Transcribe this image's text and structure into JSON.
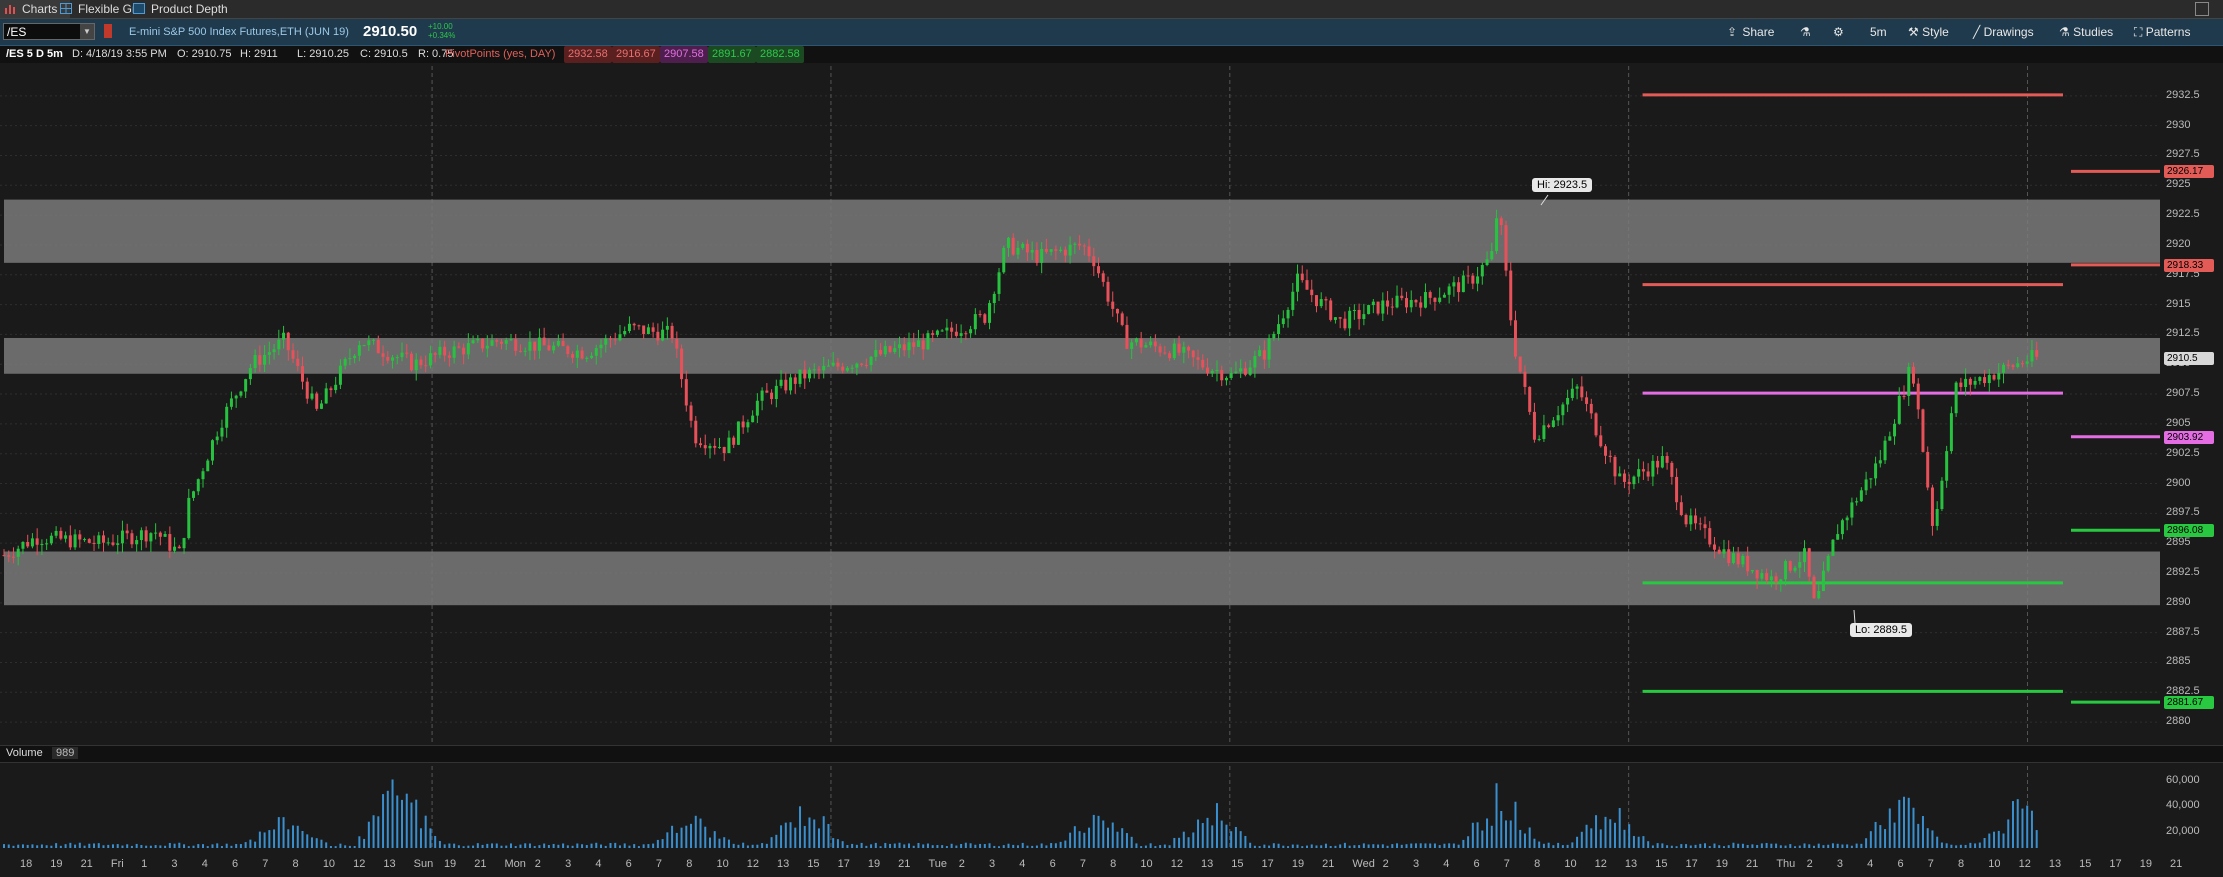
{
  "tabs": [
    {
      "label": "Charts",
      "icon": "bar-chart-icon"
    },
    {
      "label": "Flexible Grid",
      "icon": "grid-icon"
    },
    {
      "label": "Product Depth",
      "icon": "depth-icon"
    }
  ],
  "toolbar": {
    "symbol": "/ES",
    "description": "E-mini S&P 500 Index Futures,ETH (JUN 19)",
    "last_price": "2910.50",
    "change_abs": "+10.00",
    "change_pct": "+0.34%",
    "share_label": "Share",
    "timeframe_label": "5m",
    "style_label": "Style",
    "drawings_label": "Drawings",
    "studies_label": "Studies",
    "patterns_label": "Patterns"
  },
  "info": {
    "chart_label": "/ES 5 D 5m",
    "date": "D: 4/18/19 3:55 PM",
    "open": "O: 2910.75",
    "high": "H: 2911",
    "low": "L: 2910.25",
    "close": "C: 2910.5",
    "range": "R: 0.75",
    "pivot_label": "PivotPoints (yes, DAY)",
    "pivot_values": [
      "2932.58",
      "2916.67",
      "2907.58",
      "2891.67",
      "2882.58"
    ],
    "pivot_colors": [
      "#e0605a",
      "#e0605a",
      "#e070e0",
      "#2ec84a",
      "#2ec84a"
    ]
  },
  "volume": {
    "label": "Volume",
    "value": "989",
    "ticks": [
      "60,000",
      "40,000",
      "20,000"
    ]
  },
  "colors": {
    "up": "#27c23f",
    "down": "#e8505a",
    "resistance": "#e35b57",
    "pivot": "#e46de4",
    "support": "#28c940",
    "zone": "#7a7a7a",
    "volume": "#3a8fcf"
  },
  "chart_data": {
    "type": "candlestick",
    "ylim": [
      2878.5,
      2935
    ],
    "y_ticks": [
      "2932.5",
      "2930",
      "2927.5",
      "2925",
      "2922.5",
      "2920",
      "2917.5",
      "2915",
      "2912.5",
      "2910",
      "2907.5",
      "2905",
      "2902.5",
      "2900",
      "2897.5",
      "2895",
      "2892.5",
      "2890",
      "2887.5",
      "2885",
      "2882.5",
      "2880"
    ],
    "x_ticks": [
      "18",
      "19",
      "21",
      "Fri",
      "1",
      "3",
      "4",
      "6",
      "7",
      "8",
      "10",
      "12",
      "13",
      "Sun",
      "19",
      "21",
      "Mon",
      "2",
      "3",
      "4",
      "6",
      "7",
      "8",
      "10",
      "12",
      "13",
      "15",
      "17",
      "19",
      "21",
      "Tue",
      "2",
      "3",
      "4",
      "6",
      "7",
      "8",
      "10",
      "12",
      "13",
      "15",
      "17",
      "19",
      "21",
      "Wed",
      "2",
      "3",
      "4",
      "6",
      "7",
      "8",
      "10",
      "12",
      "13",
      "15",
      "17",
      "19",
      "21",
      "Thu",
      "2",
      "3",
      "4",
      "6",
      "7",
      "8",
      "10",
      "12",
      "13",
      "15",
      "17",
      "19",
      "21"
    ],
    "zones": [
      [
        2918.5,
        2923.8
      ],
      [
        2909.2,
        2912.2
      ],
      [
        2889.8,
        2894.3
      ]
    ],
    "pivots_today": [
      {
        "value": 2932.58,
        "color": "#e35b57"
      },
      {
        "value": 2916.67,
        "color": "#e35b57"
      },
      {
        "value": 2907.58,
        "color": "#e46de4"
      },
      {
        "value": 2891.67,
        "color": "#28c940"
      },
      {
        "value": 2882.58,
        "color": "#28c940"
      }
    ],
    "pivots_next": [
      {
        "value": 2926.17,
        "label": "2926.17",
        "color": "#e35b57"
      },
      {
        "value": 2918.33,
        "label": "2918.33",
        "color": "#e35b57"
      },
      {
        "value": 2903.92,
        "label": "2903.92",
        "color": "#e46de4"
      },
      {
        "value": 2896.08,
        "label": "2896.08",
        "color": "#28c940"
      },
      {
        "value": 2881.67,
        "label": "2881.67",
        "color": "#28c940"
      }
    ],
    "last_price": {
      "value": 2910.5,
      "label": "2910.5"
    },
    "hi_label": "Hi: 2923.5",
    "lo_label": "Lo: 2889.5",
    "path": [
      [
        0,
        2894
      ],
      [
        0.015,
        2895.5
      ],
      [
        0.045,
        2895
      ],
      [
        0.07,
        2896
      ],
      [
        0.082,
        2894
      ],
      [
        0.085,
        2898
      ],
      [
        0.1,
        2905
      ],
      [
        0.115,
        2910
      ],
      [
        0.13,
        2912
      ],
      [
        0.145,
        2906
      ],
      [
        0.165,
        2912
      ],
      [
        0.19,
        2910
      ],
      [
        0.205,
        2911
      ],
      [
        0.23,
        2912
      ],
      [
        0.27,
        2911
      ],
      [
        0.29,
        2913
      ],
      [
        0.31,
        2912.5
      ],
      [
        0.32,
        2904
      ],
      [
        0.335,
        2903
      ],
      [
        0.35,
        2907
      ],
      [
        0.37,
        2909
      ],
      [
        0.39,
        2910
      ],
      [
        0.41,
        2911
      ],
      [
        0.43,
        2912
      ],
      [
        0.455,
        2914
      ],
      [
        0.465,
        2920
      ],
      [
        0.48,
        2919
      ],
      [
        0.5,
        2920
      ],
      [
        0.505,
        2919
      ],
      [
        0.52,
        2912
      ],
      [
        0.545,
        2911
      ],
      [
        0.555,
        2910
      ],
      [
        0.57,
        2909
      ],
      [
        0.585,
        2911
      ],
      [
        0.6,
        2917
      ],
      [
        0.62,
        2913.5
      ],
      [
        0.64,
        2915
      ],
      [
        0.66,
        2915.5
      ],
      [
        0.68,
        2917
      ],
      [
        0.69,
        2919
      ],
      [
        0.693,
        2923.5
      ],
      [
        0.7,
        2912
      ],
      [
        0.71,
        2904
      ],
      [
        0.73,
        2908
      ],
      [
        0.75,
        2900
      ],
      [
        0.77,
        2902
      ],
      [
        0.78,
        2897
      ],
      [
        0.8,
        2894
      ],
      [
        0.82,
        2892
      ],
      [
        0.835,
        2894
      ],
      [
        0.84,
        2889.5
      ],
      [
        0.85,
        2896
      ],
      [
        0.87,
        2902
      ],
      [
        0.885,
        2910
      ],
      [
        0.895,
        2896
      ],
      [
        0.905,
        2908
      ],
      [
        0.92,
        2909
      ],
      [
        0.94,
        2910.5
      ]
    ],
    "volume_spikes": [
      [
        0.131,
        30000
      ],
      [
        0.183,
        68000
      ],
      [
        0.319,
        30000
      ],
      [
        0.372,
        40000
      ],
      [
        0.507,
        32000
      ],
      [
        0.56,
        40000
      ],
      [
        0.694,
        58000
      ],
      [
        0.745,
        42000
      ],
      [
        0.88,
        50000
      ],
      [
        0.935,
        43000
      ]
    ],
    "volume_ylim": [
      0,
      72000
    ]
  }
}
